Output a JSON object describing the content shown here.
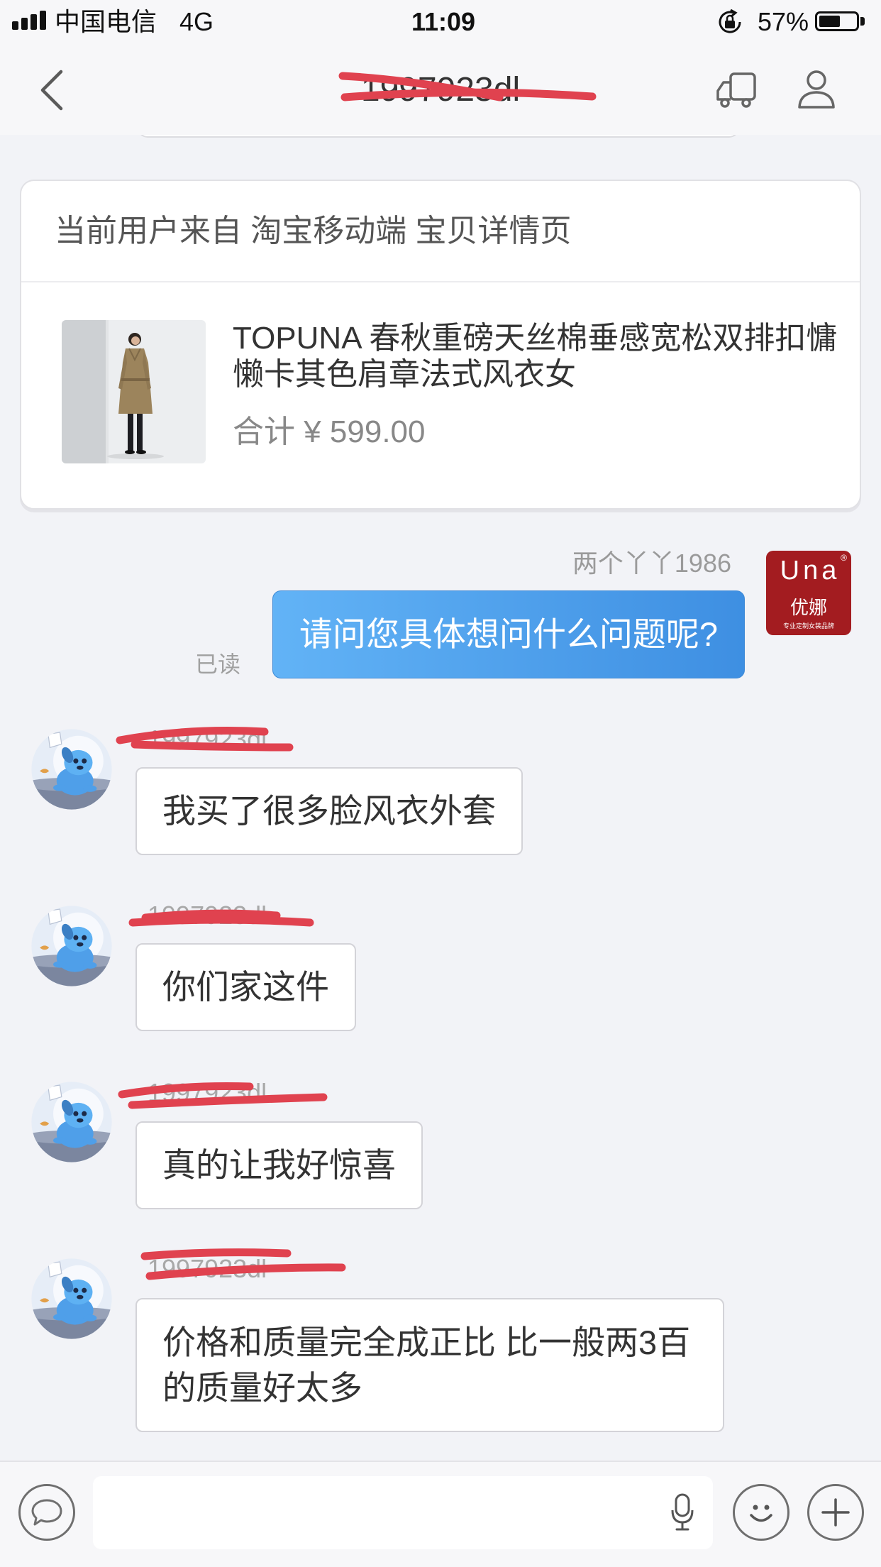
{
  "status_bar": {
    "carrier": "中国电信",
    "network": "4G",
    "time": "11:09",
    "battery_text": "57%",
    "battery_level": 0.57,
    "icons": [
      "signal-icon",
      "rotation-lock-icon",
      "battery-icon"
    ]
  },
  "nav": {
    "title": "1997923dl",
    "icons": {
      "back": "chevron-left-icon",
      "delivery": "truck-icon",
      "profile": "person-icon"
    }
  },
  "source_card": {
    "header": "当前用户来自 淘宝移动端 宝贝详情页",
    "product": {
      "title": "TOPUNA 春秋重磅天丝棉垂感宽松双排扣慵懒卡其色肩章法式风衣女",
      "total": "合计 ¥ 599.00"
    }
  },
  "shop_logo": {
    "brand": "Una",
    "registered_mark": "®",
    "name_cn": "优娜",
    "tagline": "专业定制女装品牌"
  },
  "messages": [
    {
      "direction": "outgoing",
      "sender": "两个丫丫1986",
      "text": "请问您具体想问什么问题呢?",
      "read_status": "已读"
    },
    {
      "direction": "incoming",
      "sender": "1997923dl",
      "text": "我买了很多脸风衣外套"
    },
    {
      "direction": "incoming",
      "sender": "1997923dl",
      "text": "你们家这件"
    },
    {
      "direction": "incoming",
      "sender": "1997923dl",
      "text": "真的让我好惊喜"
    },
    {
      "direction": "incoming",
      "sender": "1997923dl",
      "text": "价格和质量完全成正比 比一般两3百的质量好太多"
    }
  ],
  "input_bar": {
    "icons": [
      "chat-icon",
      "mic-icon",
      "emoji-icon",
      "plus-icon"
    ]
  },
  "colors": {
    "outgoing_bubble_start": "#62b3f6",
    "outgoing_bubble_end": "#3e8fe2",
    "brand_red": "#a31c20",
    "redaction_mark": "#e0424f"
  }
}
